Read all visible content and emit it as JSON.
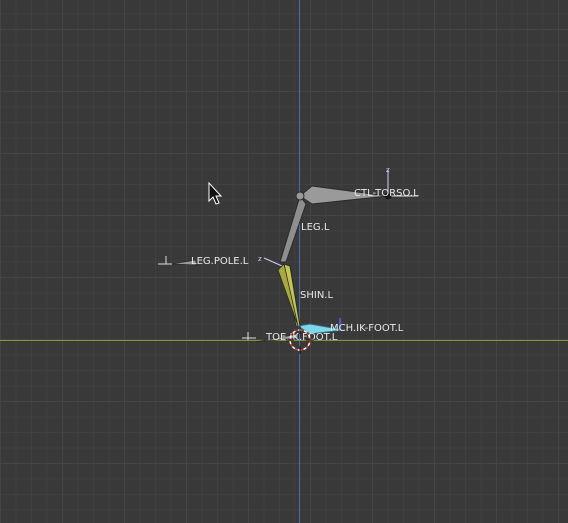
{
  "viewport": {
    "name": "3D Viewport",
    "axis_colors": {
      "vertical": "#4a6fa5",
      "horizontal": "#7d9a2a"
    }
  },
  "bones": {
    "ctl_torso": {
      "label": "CTL-TORSO.L",
      "color": "#9a9a9a"
    },
    "leg": {
      "label": "LEG.L",
      "color": "#8e8e8e"
    },
    "leg_pole": {
      "label": "LEG.POLE.L",
      "color": "#9a9a9a"
    },
    "shin": {
      "label": "SHIN.L",
      "color": "#c4c454"
    },
    "ik_foot": {
      "label": "MCH.IK-FOOT.L",
      "color": "#7ed6e8"
    },
    "toe": {
      "label": "TOE.IK.FOOT.L",
      "color": "#9a9a9a"
    }
  }
}
